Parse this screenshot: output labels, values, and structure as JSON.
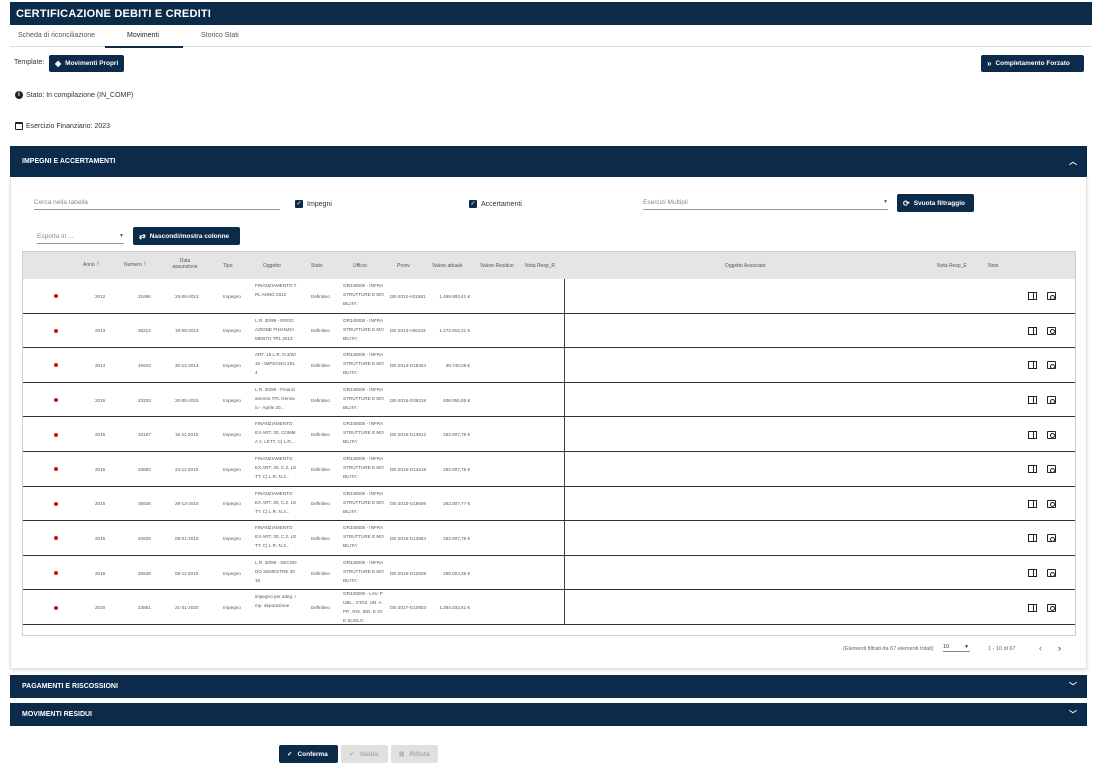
{
  "header": {
    "title": "CERTIFICAZIONE DEBITI E CREDITI"
  },
  "tabs": [
    {
      "label": "Scheda di riconciliazione"
    },
    {
      "label": "Movimenti"
    },
    {
      "label": "Storico Stati"
    }
  ],
  "template": {
    "label": "Template:",
    "button": "Movimenti Propri"
  },
  "forced_completion_button": "Completamento Forzato",
  "status_text": "Stato: In compilazione (IN_COMP)",
  "fiscal_year_text": "Esercizio Finanziario: 2023",
  "panels": {
    "impegni": "IMPEGNI E ACCERTAMENTI",
    "pagamenti": "PAGAMENTI E RISCOSSIONI",
    "residui": "MOVIMENTI RESIDUI"
  },
  "filters": {
    "search_placeholder": "Cerca nella tabella",
    "impegni_label": "Impegni",
    "accertamenti_label": "Accertamenti",
    "esercizi_placeholder": "Esercizi Multipli",
    "clear_button": "Svuota filtraggio",
    "export_placeholder": "Esporta in ...",
    "columns_button": "Nascondi/mostra colonne"
  },
  "table": {
    "headers": {
      "anno": "Anno",
      "numero": "Numero",
      "data": "Data assunzione",
      "tipo": "Tipo",
      "oggetto": "Oggetto",
      "stato": "Stato",
      "ufficio": "Ufficio",
      "provv": "Provv",
      "valore_attuale": "Valore attuale",
      "valore_residuo": "Valore Residuo",
      "nota_r": "Nota Resp_R",
      "oggetto_associato": "Oggetto Associato",
      "nota_e": "Nota Resp_E",
      "note": "Note"
    },
    "rows": [
      {
        "anno": "2012",
        "numero": "31696",
        "data": "23-08-2012",
        "tipo": "Impegno",
        "oggetto": [
          "FINANZIAMENTO T",
          "PL ANNO 2012",
          ""
        ],
        "stato": "Definitivo",
        "ufficio": [
          "GR340000 - INFRA",
          "STRUTTURE E MO",
          "BILITA'"
        ],
        "provv": "DE-2012-A01581",
        "valore": "1.499.900,41 €"
      },
      {
        "anno": "2013",
        "numero": "38212",
        "data": "19-08-2013",
        "tipo": "Impegno",
        "oggetto": [
          "L.R. 30/98 - EROG",
          "AZIONE FINANZIA",
          "MENTO TPL 2013"
        ],
        "stato": "Definitivo",
        "ufficio": [
          "GR340000 - INFRA",
          "STRUTTURE E MO",
          "BILITA'"
        ],
        "provv": "DE-2013-A06133",
        "valore": "1.272.918,31 €"
      },
      {
        "anno": "2014",
        "numero": "46943",
        "data": "30-12-2014",
        "tipo": "Impegno",
        "oggetto": [
          "ART. 15 L.R. N.3/20",
          "10 - IMPEGNO 201",
          "4"
        ],
        "stato": "Definitivo",
        "ufficio": [
          "GR340000 - INFRA",
          "STRUTTURE E MO",
          "BILITA'"
        ],
        "provv": "DE-2014-G18424",
        "valore": "39.746,08 €"
      },
      {
        "anno": "2015",
        "numero": "23333",
        "data": "20-05-2015",
        "tipo": "Impegno",
        "oggetto": [
          "L.R. 30/98 - Finanzi",
          "amento TPL Genna",
          "io - Aprile 20..."
        ],
        "stato": "Definitivo",
        "ufficio": [
          "GR340000 - INFRA",
          "STRUTTURE E MO",
          "BILITA'"
        ],
        "provv": "DE-2015-G06218",
        "valore": "508.055,85 €"
      },
      {
        "anno": "2015",
        "numero": "33197",
        "data": "16-11-2015",
        "tipo": "Impegno",
        "oggetto": [
          "FINANZIAMENTO",
          "EX ART. 30, COMM",
          "A 2, LETT. C) L.R...."
        ],
        "stato": "Definitivo",
        "ufficio": [
          "GR340000 - INFRA",
          "STRUTTURE E MO",
          "BILITA'"
        ],
        "provv": "DE-2015-G13812",
        "valore": "263.007,76 €"
      },
      {
        "anno": "2015",
        "numero": "33892",
        "data": "24-11-2015",
        "tipo": "Impegno",
        "oggetto": [
          "FINANZIAMENTO",
          "EX ART. 30, C.2, LE",
          "TT. C) L.R. N.3..."
        ],
        "stato": "Definitivo",
        "ufficio": [
          "GR340000 - INFRA",
          "STRUTTURE E MO",
          "BILITA'"
        ],
        "provv": "DE-2015-G14218",
        "valore": "263.007,76 €"
      },
      {
        "anno": "2015",
        "numero": "36636",
        "data": "29-12-2015",
        "tipo": "Impegno",
        "oggetto": [
          "FINANZIAMENTO",
          "EX ART. 30, C.2, LE",
          "TT. C) L.R. N.3..."
        ],
        "stato": "Definitivo",
        "ufficio": [
          "GR340000 - INFRA",
          "STRUTTURE E MO",
          "BILITA'"
        ],
        "provv": "DE-2015-G16606",
        "valore": "263.007,77 €"
      },
      {
        "anno": "2015",
        "numero": "40625",
        "data": "08-01-2016",
        "tipo": "Impegno",
        "oggetto": [
          "FINANZIAMENTO",
          "EX ART. 30, C.2, LE",
          "TT. C) L.R. N.3..."
        ],
        "stato": "Definitivo",
        "ufficio": [
          "GR340000 - INFRA",
          "STRUTTURE E MO",
          "BILITA'"
        ],
        "provv": "DE-2015-G13864",
        "valore": "263.007,76 €"
      },
      {
        "anno": "2016",
        "numero": "30648",
        "data": "09-11-2016",
        "tipo": "Impegno",
        "oggetto": [
          "L.R. 30/98 - SECON",
          "DO SEMESTRE 20",
          "16"
        ],
        "stato": "Definitivo",
        "ufficio": [
          "GR340000 - INFRA",
          "STRUTTURE E MO",
          "BILITA'"
        ],
        "provv": "DE-2016-G12509",
        "valore": "299.023,36 €"
      },
      {
        "anno": "2020",
        "numero": "23881",
        "data": "21-01-2020",
        "tipo": "Impegno",
        "oggetto": [
          "",
          "impegno per adeg. i",
          "mp. depurazione"
        ],
        "stato": "Definitivo",
        "ufficio": [
          "GR420000 - LAV. P",
          "UBL., STAZ. UN. A",
          "PP., RIS. IDR. E DI",
          "E SUOLO"
        ],
        "provv": "DE-2017-G10803",
        "valore": "1.394.033,61 €"
      }
    ]
  },
  "pagination": {
    "summary": "(Elementi filtrati da 67 elementi totali)",
    "page_size": "10",
    "range": "1 - 10 di 67"
  },
  "footer": {
    "confirm": "Conferma",
    "validate": "Valida",
    "reject": "Rifiuta"
  },
  "colors": {
    "primary": "#0c2a4a",
    "status_dot": "#cc1111"
  },
  "icons": [
    "tag-icon",
    "double-chevron-right-icon",
    "info-icon",
    "calendar-icon",
    "refresh-icon",
    "columns-icon",
    "book-icon",
    "eye-icon",
    "check-icon",
    "close-icon",
    "chevron-up-icon",
    "chevron-down-icon"
  ]
}
